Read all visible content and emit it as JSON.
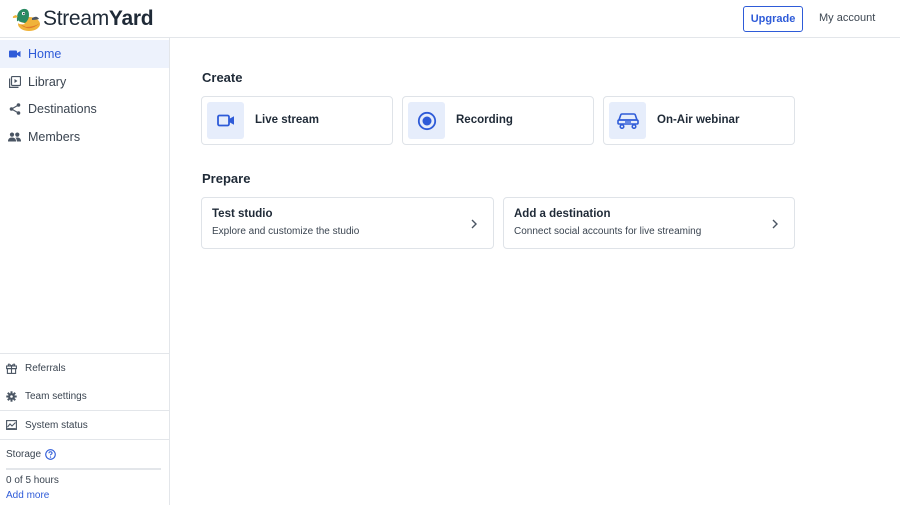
{
  "brand": {
    "name_light": "Stream",
    "name_bold": "Yard",
    "logo_icon": "duck-logo-icon"
  },
  "header": {
    "upgrade_label": "Upgrade",
    "account_label": "My account"
  },
  "sidebar": {
    "nav": [
      {
        "label": "Home",
        "icon": "video-camera-icon",
        "active": true
      },
      {
        "label": "Library",
        "icon": "library-icon",
        "active": false
      },
      {
        "label": "Destinations",
        "icon": "share-icon",
        "active": false
      },
      {
        "label": "Members",
        "icon": "people-icon",
        "active": false
      }
    ],
    "utilities": [
      {
        "label": "Referrals",
        "icon": "gift-icon"
      },
      {
        "label": "Team settings",
        "icon": "gear-icon"
      },
      {
        "label": "System status",
        "icon": "system-status-icon"
      }
    ],
    "storage": {
      "label": "Storage",
      "used": 0,
      "total": 5,
      "count_text": "0 of 5 hours",
      "add_more": "Add more"
    }
  },
  "main": {
    "create_title": "Create",
    "create_cards": [
      {
        "label": "Live stream",
        "icon": "video-camera-icon"
      },
      {
        "label": "Recording",
        "icon": "record-icon"
      },
      {
        "label": "On-Air webinar",
        "icon": "webinar-icon"
      }
    ],
    "prepare_title": "Prepare",
    "prepare_cards": [
      {
        "title": "Test studio",
        "description": "Explore and customize the studio"
      },
      {
        "title": "Add a destination",
        "description": "Connect social accounts for live streaming"
      }
    ]
  },
  "colors": {
    "accent": "#2e5bd8",
    "active_bg": "#edf2fc",
    "tile_bg": "#e6edfb",
    "border": "#dfe3e8"
  }
}
